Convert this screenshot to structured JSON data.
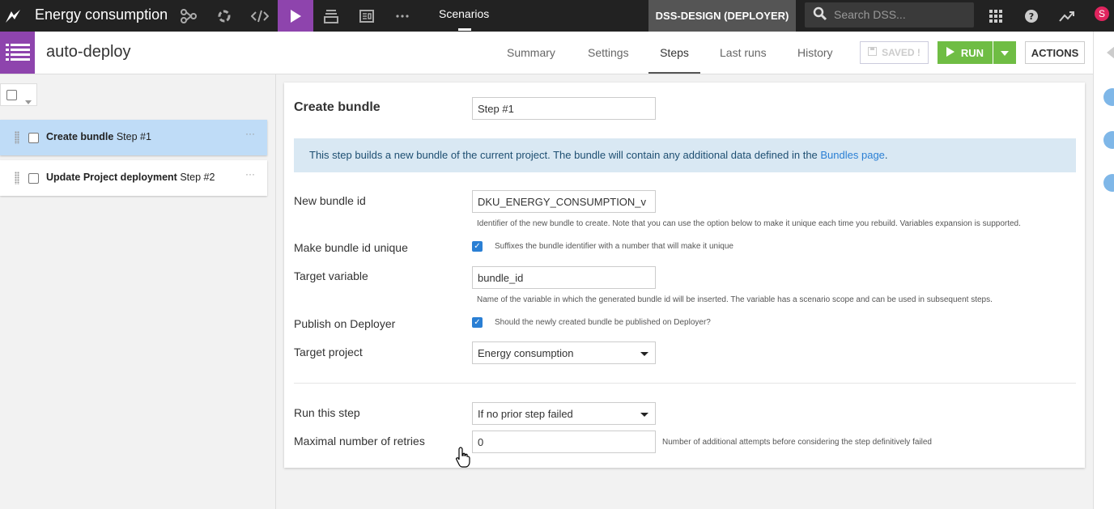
{
  "nav": {
    "project_name": "Energy consumption",
    "current_section": "Scenarios",
    "instance": "DSS-DESIGN (DEPLOYER)",
    "search_placeholder": "Search DSS...",
    "user_initial": "S",
    "icons": [
      "flow-icon",
      "recipes-icon",
      "code-icon",
      "jobs-icon",
      "datasets-icon",
      "dashboards-icon",
      "more-icon"
    ]
  },
  "header": {
    "scenario_name": "auto-deploy",
    "tabs": [
      "Summary",
      "Settings",
      "Steps",
      "Last runs",
      "History"
    ],
    "active_tab": "Steps",
    "saved_label": "SAVED !",
    "run_label": "RUN",
    "actions_label": "ACTIONS",
    "colors": {
      "accent": "#8e44ad",
      "run": "#6fbd44"
    }
  },
  "steps": [
    {
      "name": "Create bundle",
      "num": "Step #1",
      "selected": true
    },
    {
      "name": "Update Project deployment",
      "num": "Step #2",
      "selected": false
    }
  ],
  "form": {
    "title": "Create bundle",
    "step_name_value": "Step #1",
    "info_text": "This step builds a new bundle of the current project. The bundle will contain any additional data defined in the ",
    "info_link": "Bundles page",
    "info_end": ".",
    "new_bundle_id_label": "New bundle id",
    "new_bundle_id_value": "DKU_ENERGY_CONSUMPTION_v",
    "new_bundle_id_help": "Identifier of the new bundle to create. Note that you can use the option below to make it unique each time you rebuild. Variables expansion is supported.",
    "unique_label": "Make bundle id unique",
    "unique_help": "Suffixes the bundle identifier with a number that will make it unique",
    "target_variable_label": "Target variable",
    "target_variable_value": "bundle_id",
    "target_variable_help": "Name of the variable in which the generated bundle id will be inserted. The variable has a scenario scope and can be used in subsequent steps.",
    "publish_label": "Publish on Deployer",
    "publish_help": "Should the newly created bundle be published on Deployer?",
    "target_project_label": "Target project",
    "target_project_value": "Energy consumption",
    "run_step_label": "Run this step",
    "run_step_value": "If no prior step failed",
    "max_retries_label": "Maximal number of retries",
    "max_retries_value": "0",
    "max_retries_help": "Number of additional attempts before considering the step definitively failed"
  }
}
